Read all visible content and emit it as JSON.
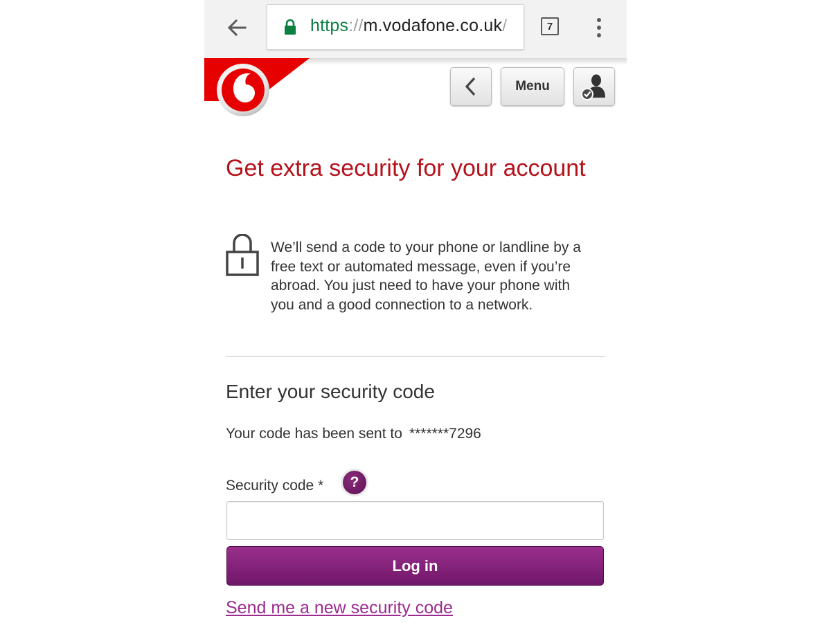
{
  "browser": {
    "url_scheme": "https",
    "url_separator": "://",
    "url_host": "m.vodafone.co.uk",
    "url_trailing": "/",
    "tab_count": "7"
  },
  "header": {
    "menu_label": "Menu",
    "brand_color": "#e60000",
    "icons": [
      "back-arrow-icon",
      "lock-icon",
      "kebab-menu-icon",
      "vodafone-logo",
      "chevron-left-icon",
      "account-verified-icon"
    ]
  },
  "main": {
    "title": "Get extra security for your account",
    "info_text": "We’ll send a code to your phone or landline by a free text or automated message, even if you’re abroad. You just need to have your phone with you and a good connection to a network.",
    "subtitle": "Enter your security code",
    "sent_label": "Your code has been sent to",
    "sent_number": "*******7296",
    "field_label": "Security code *",
    "help_symbol": "?",
    "input_value": "",
    "login_label": "Log in",
    "resend_link": "Send me a new security code"
  },
  "colors": {
    "title": "#b5121b",
    "button": "#7d1f75",
    "link": "#9c2a8f",
    "secure_url": "#0b8043"
  }
}
